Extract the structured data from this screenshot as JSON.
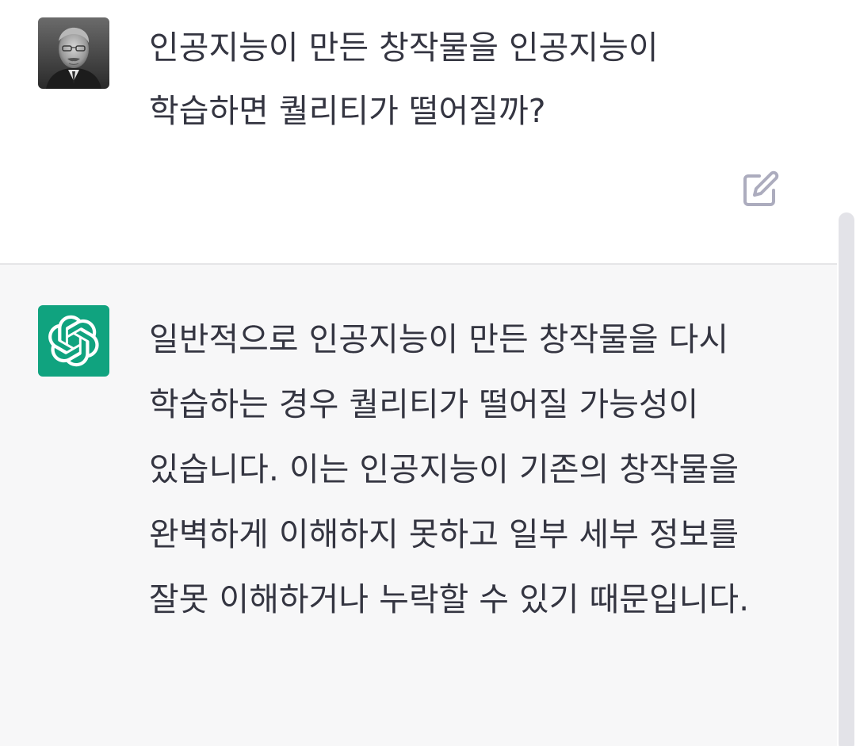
{
  "conversation": {
    "user": {
      "avatar_icon": "user-portrait-avatar",
      "message": "인공지능이 만든 창작물을 인공지능이 학습하면 퀄리티가 떨어질까?",
      "edit_icon": "edit-icon"
    },
    "assistant": {
      "avatar_icon": "openai-logo-icon",
      "avatar_color": "#10a37f",
      "message": "일반적으로 인공지능이 만든 창작물을 다시 학습하는 경우 퀄리티가 떨어질 가능성이 있습니다. 이는 인공지능이 기존의 창작물을 완벽하게 이해하지 못하고 일부 세부 정보를 잘못 이해하거나 누락할 수 있기 때문입니다."
    }
  },
  "colors": {
    "user_bg": "#ffffff",
    "assistant_bg": "#f7f7f8",
    "text": "#343541",
    "icon_gray": "#acacbe",
    "accent": "#10a37f"
  }
}
